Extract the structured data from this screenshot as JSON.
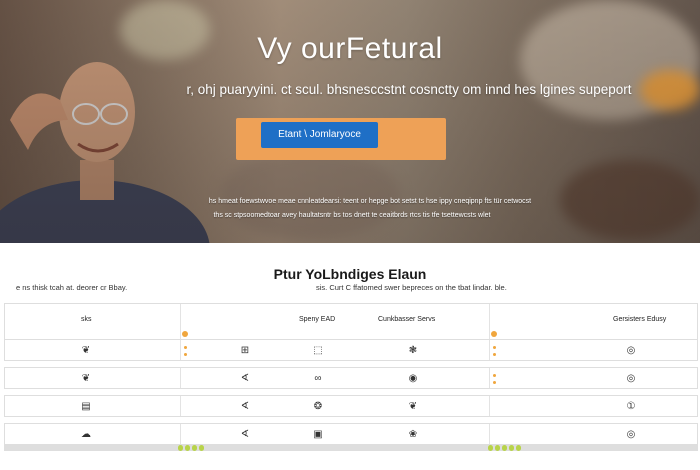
{
  "hero": {
    "title": "Vy ourFetural",
    "subtitle": "r, ohj puaryyini. ct scul. bhsnesccstnt cosnctty om innd hes lgines supeport",
    "cta_label": "Etant \\ Jomlaryoce",
    "note_line1": "hs hmeat foewstwvoe meae cnnleatdearsi: teent  or hepge bot setst ts hse ippy cneqipnp fts tür cetwocst",
    "note_line2": "ths sc stpsoomedtoar avey haultatsntr bs tos dnett  te ceaitbrds rtcs tis tfe tsettewcsts wlet"
  },
  "features": {
    "title": "Ptur YoLbndiges Elaun",
    "left_caption": "e ns thisk tcah at. deorer cr Bbay.",
    "right_caption": "sis. Curt C ffatomed swer bepreces on the tbat lindar. ble.",
    "columns": [
      "sks",
      "Speny EAD",
      "Cunkbasser Servs",
      "Gersisters Edusy"
    ],
    "rows": [
      {
        "icons": [
          "❦",
          "⊞",
          "⬚",
          "❃",
          "◎"
        ]
      },
      {
        "icons": [
          "❦",
          "∢",
          "∞",
          "◉",
          "◎"
        ]
      },
      {
        "icons": [
          "▤",
          "∢",
          "❂",
          "❦",
          "①"
        ]
      },
      {
        "icons": [
          "☁",
          "∢",
          "▣",
          "❀",
          "◎"
        ]
      }
    ]
  },
  "colors": {
    "accent_orange": "#eea157",
    "cta_blue": "#1f6fc6",
    "dot_orange": "#f0a63d",
    "bar_green": "#b8d34a"
  }
}
